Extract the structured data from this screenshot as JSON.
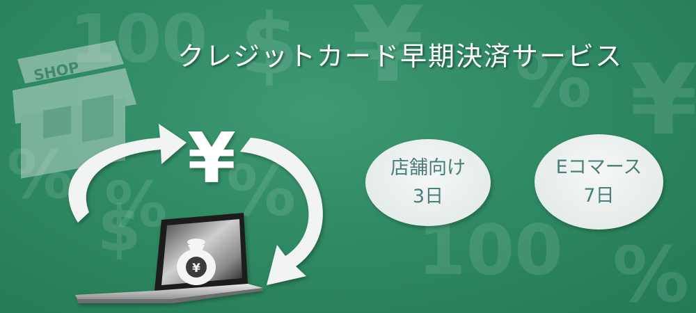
{
  "banner": {
    "title": "クレジットカード早期決済サービス",
    "shop_sign": "SHOP",
    "yen_symbol": "¥",
    "bag_symbol": "¥",
    "background_symbols": [
      "¥",
      "$",
      "%",
      "100"
    ]
  },
  "offers": [
    {
      "label": "店舗向け",
      "duration": "3日"
    },
    {
      "label": "Eコマース",
      "duration": "7日"
    }
  ],
  "colors": {
    "background": "#2f8a63",
    "title": "#ffffff",
    "bubble": "#eef2f0",
    "bubble_text": "#4a7e7a"
  },
  "icons": [
    "shop-icon",
    "yen-icon",
    "arrow-cycle-icon",
    "laptop-icon",
    "money-bag-icon"
  ]
}
